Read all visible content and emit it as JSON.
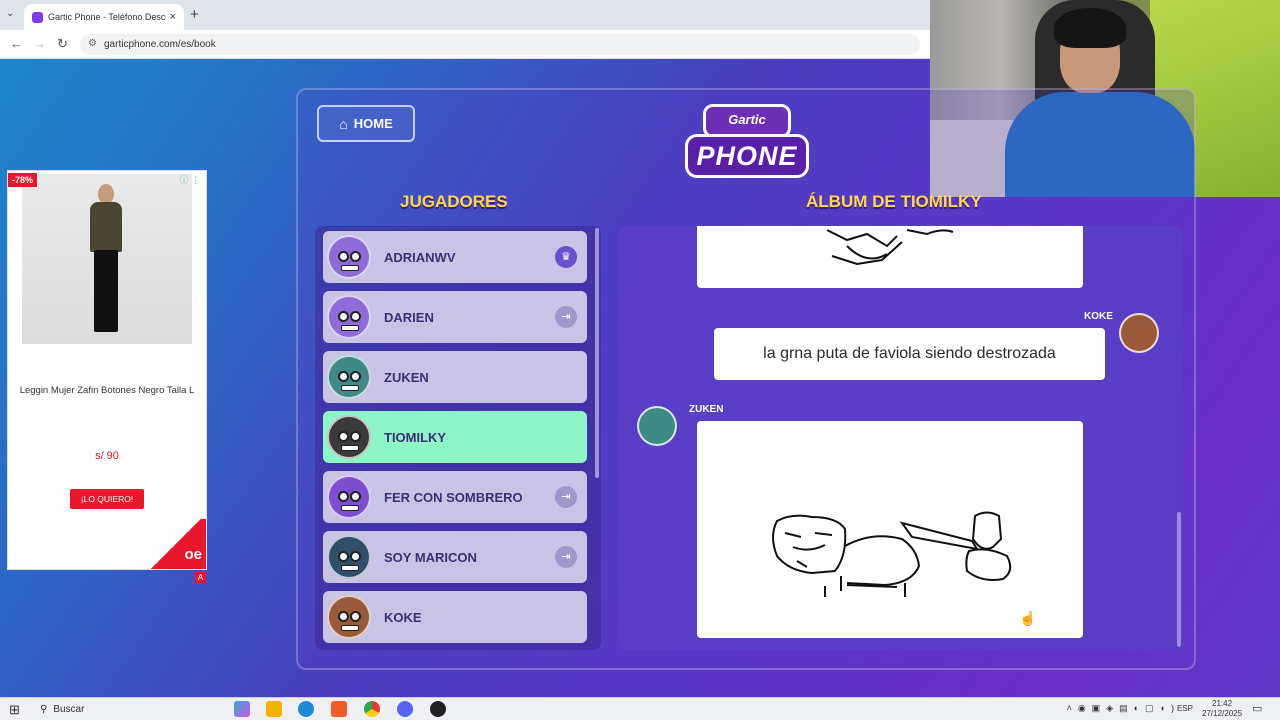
{
  "browser": {
    "tab_title": "Gartic Phone - Teléfono Descon",
    "url": "garticphone.com/es/book",
    "new_tab": "+",
    "close": "×"
  },
  "ad": {
    "discount": "-78%",
    "product_name": "Leggin Mujer Zafin Botones Negro Talla L",
    "price": "s/ 90",
    "cta": "¡LO QUIERO!",
    "brand_logo": "oe",
    "badge": "A"
  },
  "game": {
    "home_label": "HOME",
    "logo_top": "Gartic",
    "logo_bottom": "PHONE",
    "players_title": "JUGADORES",
    "album_title": "ÁLBUM DE TIOMILKY",
    "players": [
      {
        "name": "ADRIANWV",
        "color": "#8e6bd8",
        "action": "crown-icon"
      },
      {
        "name": "DARIEN",
        "color": "#8e6bd8",
        "action": "kick-icon"
      },
      {
        "name": "ZUKEN",
        "color": "#3f8a86",
        "action": ""
      },
      {
        "name": "TIOMILKY",
        "color": "#3a3a3a",
        "action": ""
      },
      {
        "name": "FER CON SOMBRERO",
        "color": "#7c4fd0",
        "action": "kick-icon"
      },
      {
        "name": "SOY MARICON",
        "color": "#2f4e6a",
        "action": "kick-icon"
      },
      {
        "name": "KOKE",
        "color": "#9a5a3a",
        "action": ""
      }
    ],
    "album": {
      "text_sender": "KOKE",
      "text_message": "la grna puta de faviola siendo destrozada",
      "drawing_sender": "ZUKEN"
    }
  },
  "taskbar": {
    "search": "Buscar",
    "lang": "ESP",
    "time": "21:42",
    "date": "27/12/2025"
  }
}
